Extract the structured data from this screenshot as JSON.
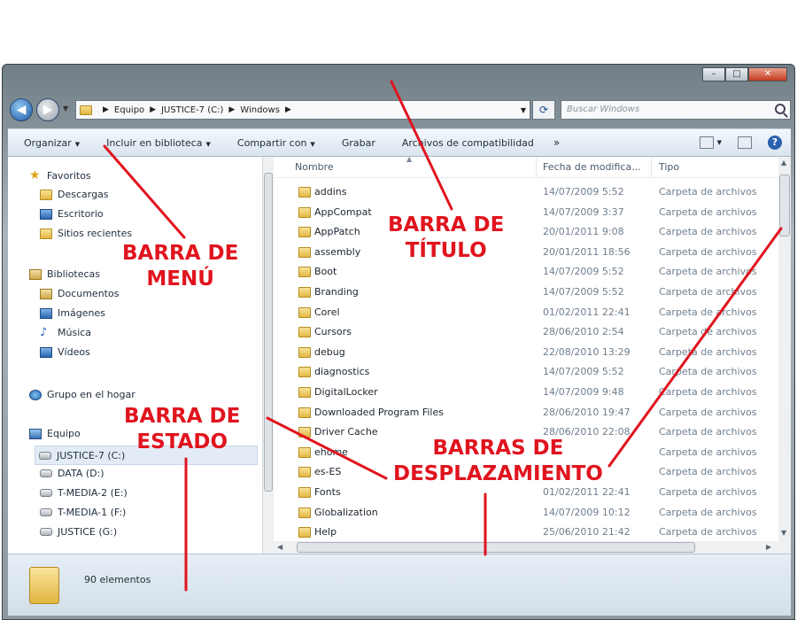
{
  "window": {
    "caption_buttons": [
      "–",
      "□",
      "✕"
    ]
  },
  "address": {
    "crumbs": [
      "Equipo",
      "JUSTICE-7 (C:)",
      "Windows"
    ],
    "search_placeholder": "Buscar Windows"
  },
  "commands": {
    "organize": "Organizar",
    "include_library": "Incluir en biblioteca",
    "share_with": "Compartir con",
    "burn": "Grabar",
    "compat_files": "Archivos de compatibilidad",
    "more": "»"
  },
  "nav": {
    "favorites": "Favoritos",
    "downloads": "Descargas",
    "desktop": "Escritorio",
    "recent": "Sitios recientes",
    "libraries": "Bibliotecas",
    "documents": "Documentos",
    "images": "Imágenes",
    "music": "Música",
    "videos": "Vídeos",
    "homegroup": "Grupo en el hogar",
    "computer": "Equipo",
    "drives": [
      "JUSTICE-7 (C:)",
      "DATA (D:)",
      "T-MEDIA-2 (E:)",
      "T-MEDIA-1 (F:)",
      "JUSTICE (G:)"
    ]
  },
  "columns": {
    "name": "Nombre",
    "date": "Fecha de modifica...",
    "type": "Tipo"
  },
  "files": [
    {
      "name": "addins",
      "date": "14/07/2009 5:52",
      "type": "Carpeta de archivos"
    },
    {
      "name": "AppCompat",
      "date": "14/07/2009 3:37",
      "type": "Carpeta de archivos"
    },
    {
      "name": "AppPatch",
      "date": "20/01/2011 9:08",
      "type": "Carpeta de archivos"
    },
    {
      "name": "assembly",
      "date": "20/01/2011 18:56",
      "type": "Carpeta de archivos"
    },
    {
      "name": "Boot",
      "date": "14/07/2009 5:52",
      "type": "Carpeta de archivos"
    },
    {
      "name": "Branding",
      "date": "14/07/2009 5:52",
      "type": "Carpeta de archivos"
    },
    {
      "name": "Corel",
      "date": "01/02/2011 22:41",
      "type": "Carpeta de archivos"
    },
    {
      "name": "Cursors",
      "date": "28/06/2010 2:54",
      "type": "Carpeta de archivos"
    },
    {
      "name": "debug",
      "date": "22/08/2010 13:29",
      "type": "Carpeta de archivos"
    },
    {
      "name": "diagnostics",
      "date": "14/07/2009 5:52",
      "type": "Carpeta de archivos"
    },
    {
      "name": "DigitalLocker",
      "date": "14/07/2009 9:48",
      "type": "Carpeta de archivos"
    },
    {
      "name": "Downloaded Program Files",
      "date": "28/06/2010 19:47",
      "type": "Carpeta de archivos"
    },
    {
      "name": "Driver Cache",
      "date": "28/06/2010 22:08",
      "type": "Carpeta de archivos"
    },
    {
      "name": "ehome",
      "date": "",
      "type": "Carpeta de archivos"
    },
    {
      "name": "es-ES",
      "date": "",
      "type": "Carpeta de archivos"
    },
    {
      "name": "Fonts",
      "date": "01/02/2011 22:41",
      "type": "Carpeta de archivos"
    },
    {
      "name": "Globalization",
      "date": "14/07/2009 10:12",
      "type": "Carpeta de archivos"
    },
    {
      "name": "Help",
      "date": "25/06/2010 21:42",
      "type": "Carpeta de archivos"
    }
  ],
  "status": {
    "count": "90 elementos"
  },
  "annotations": {
    "title_bar": [
      "BARRA DE",
      "TÍTULO"
    ],
    "menu_bar": [
      "BARRA DE",
      "MENÚ"
    ],
    "status_bar": [
      "BARRA DE",
      "ESTADO"
    ],
    "scroll_bars": [
      "BARRAS DE",
      "DESPLAZAMIENTO"
    ],
    "color": "#e0141e"
  }
}
